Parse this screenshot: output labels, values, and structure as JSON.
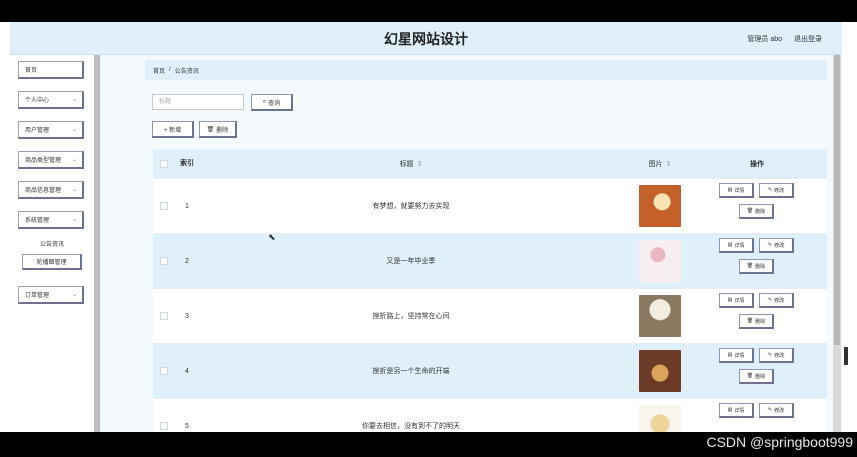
{
  "window": {
    "app_title": "幻星网站设计",
    "user_label": "管理员 abo",
    "logout_label": "退出登录"
  },
  "sidebar": {
    "items": [
      {
        "label": "首页",
        "has_chevron": false
      },
      {
        "label": "个人中心",
        "has_chevron": true
      },
      {
        "label": "用户管理",
        "has_chevron": true
      },
      {
        "label": "商品类型管理",
        "has_chevron": true
      },
      {
        "label": "商品信息管理",
        "has_chevron": true
      },
      {
        "label": "系统管理",
        "has_chevron": true
      },
      {
        "label": "公告资讯",
        "has_chevron": false
      },
      {
        "label": "轮播图管理",
        "has_chevron": false
      },
      {
        "label": "订单管理",
        "has_chevron": true
      }
    ],
    "chevron_icon": "chevron-down-icon"
  },
  "breadcrumb": {
    "home": "首页",
    "separator": "/",
    "current": "公告资讯"
  },
  "search": {
    "placeholder": "标题",
    "button_label": "查询"
  },
  "toolbar": {
    "add_label": "+ 新增",
    "delete_label": "删除"
  },
  "table": {
    "headers": {
      "index": "索引",
      "title": "标题",
      "image": "图片",
      "actions": "操作"
    },
    "sort_indicator": "⇕",
    "rows": [
      {
        "index": "1",
        "title": "有梦想，就要努力去实现",
        "image_color": "#c4612b"
      },
      {
        "index": "2",
        "title": "又是一年毕业季",
        "image_color": "#f1dfe3"
      },
      {
        "index": "3",
        "title": "挫折路上，坚持常在心间",
        "image_color": "#8a7960"
      },
      {
        "index": "4",
        "title": "挫折是另一个生命的开端",
        "image_color": "#6b3b25"
      },
      {
        "index": "5",
        "title": "你要去相信，没有到不了的明天",
        "image_color": "#f0d59a"
      }
    ],
    "row_actions": {
      "detail": "详情",
      "edit": "修改",
      "delete": "删除"
    }
  },
  "watermark": "CSDN @springboot999",
  "colors": {
    "header_bg": "#dff0fb",
    "row_alt_bg": "#dff0fb",
    "button_border": "#6d7291"
  }
}
